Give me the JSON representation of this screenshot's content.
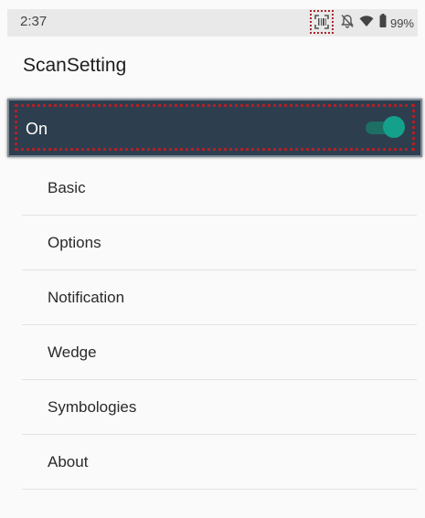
{
  "status_bar": {
    "time": "2:37",
    "battery": "99%",
    "icons": [
      "barcode-scan-icon",
      "bell-off-icon",
      "wifi-icon",
      "battery-icon"
    ]
  },
  "app_bar": {
    "title": "ScanSetting"
  },
  "master_switch": {
    "label": "On",
    "checked": true
  },
  "menu": {
    "items": [
      {
        "label": "Basic"
      },
      {
        "label": "Options"
      },
      {
        "label": "Notification"
      },
      {
        "label": "Wedge"
      },
      {
        "label": "Symbologies"
      },
      {
        "label": "About"
      }
    ]
  },
  "colors": {
    "toggle_bar_bg": "#2d3e4e",
    "switch_thumb": "#15a08b",
    "highlight_dotted": "#b0212a"
  }
}
